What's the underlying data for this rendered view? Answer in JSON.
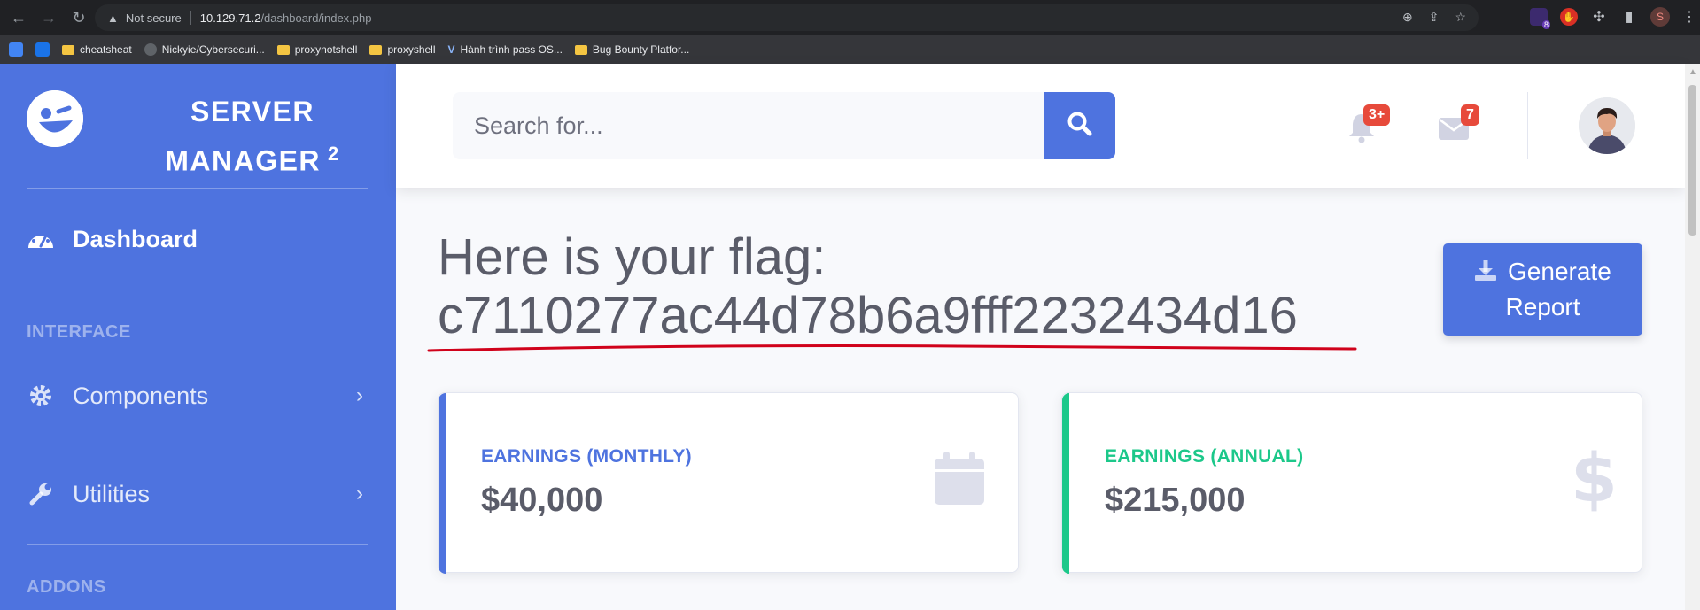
{
  "browser": {
    "not_secure": "Not secure",
    "url_host": "10.129.71.2",
    "url_path": "/dashboard/index.php",
    "ext_badge": "8",
    "profile_initial": "S",
    "bookmarks": [
      {
        "label": "cheatsheat",
        "icon": "folder-icon"
      },
      {
        "label": "Nickyie/Cybersecuri...",
        "icon": "github-icon"
      },
      {
        "label": "proxynotshell",
        "icon": "folder-icon"
      },
      {
        "label": "proxyshell",
        "icon": "folder-icon"
      },
      {
        "label": "Hành trình pass OS...",
        "icon": "v-icon"
      },
      {
        "label": "Bug Bounty Platfor...",
        "icon": "folder-icon"
      }
    ]
  },
  "sidebar": {
    "brand_line1": "SERVER",
    "brand_line2": "MANAGER",
    "brand_sup": "2",
    "dashboard": "Dashboard",
    "interface_heading": "INTERFACE",
    "components": "Components",
    "utilities": "Utilities",
    "addons_heading": "ADDONS"
  },
  "topbar": {
    "search_placeholder": "Search for...",
    "alerts_count": "3+",
    "messages_count": "7"
  },
  "main": {
    "flag_label": "Here is your flag:",
    "flag_value": "c7110277ac44d78b6a9fff2232434d16",
    "generate_line1": "Generate",
    "generate_line2": "Report"
  },
  "cards": [
    {
      "label": "EARNINGS (MONTHLY)",
      "value": "$40,000",
      "color": "#4e73df",
      "icon": "calendar-icon"
    },
    {
      "label": "EARNINGS (ANNUAL)",
      "value": "$215,000",
      "color": "#1cc88a",
      "icon": "dollar-icon"
    }
  ],
  "colors": {
    "primary": "#4e73df",
    "success": "#1cc88a",
    "danger": "#e74a3b",
    "annotation_red": "#d0021b"
  }
}
